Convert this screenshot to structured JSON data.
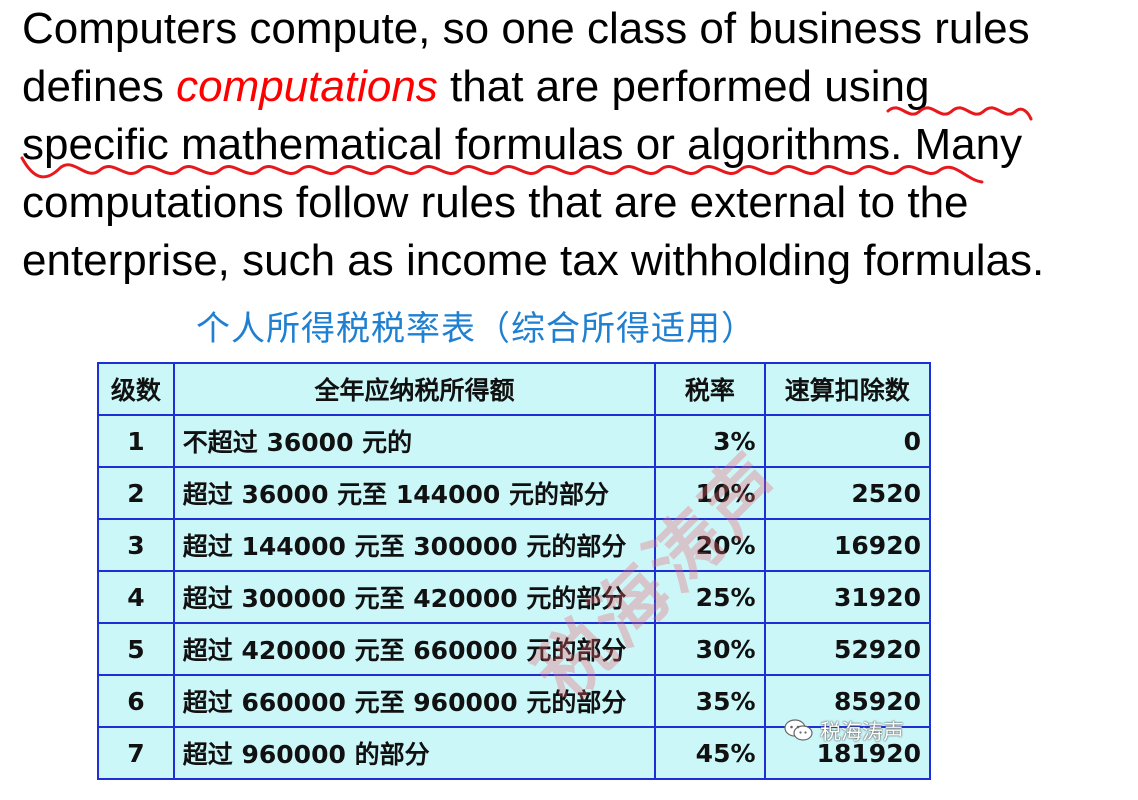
{
  "paragraph": {
    "line1": "Computers compute, so one class of business rules",
    "line2_pre": "defines ",
    "line2_emph": "computations",
    "line2_post": " that are performed using",
    "line3": "specific mathematical formulas or algorithms. Many",
    "line4": "computations follow rules that are external to the",
    "line5": "enterprise, such as income tax withholding formulas."
  },
  "annotation_color": "#e8191c",
  "table": {
    "title": "个人所得税税率表（综合所得适用）",
    "headers": [
      "级数",
      "全年应纳税所得额",
      "税率",
      "速算扣除数"
    ],
    "rows": [
      [
        "1",
        "不超过 36000 元的",
        "3%",
        "0"
      ],
      [
        "2",
        "超过 36000 元至 144000 元的部分",
        "10%",
        "2520"
      ],
      [
        "3",
        "超过 144000 元至 300000 元的部分",
        "20%",
        "16920"
      ],
      [
        "4",
        "超过 300000 元至 420000 元的部分",
        "25%",
        "31920"
      ],
      [
        "5",
        "超过 420000 元至 660000 元的部分",
        "30%",
        "52920"
      ],
      [
        "6",
        "超过 660000 元至 960000 元的部分",
        "35%",
        "85920"
      ],
      [
        "7",
        "超过 960000 的部分",
        "45%",
        "181920"
      ]
    ],
    "background_color": "#ccf7f9",
    "border_color": "#1e2fd6",
    "title_color": "#1f7fd0"
  },
  "watermark": {
    "text": "税海涛声",
    "wechat_text": "税海涛声",
    "wechat_icon": "wechat-icon"
  }
}
